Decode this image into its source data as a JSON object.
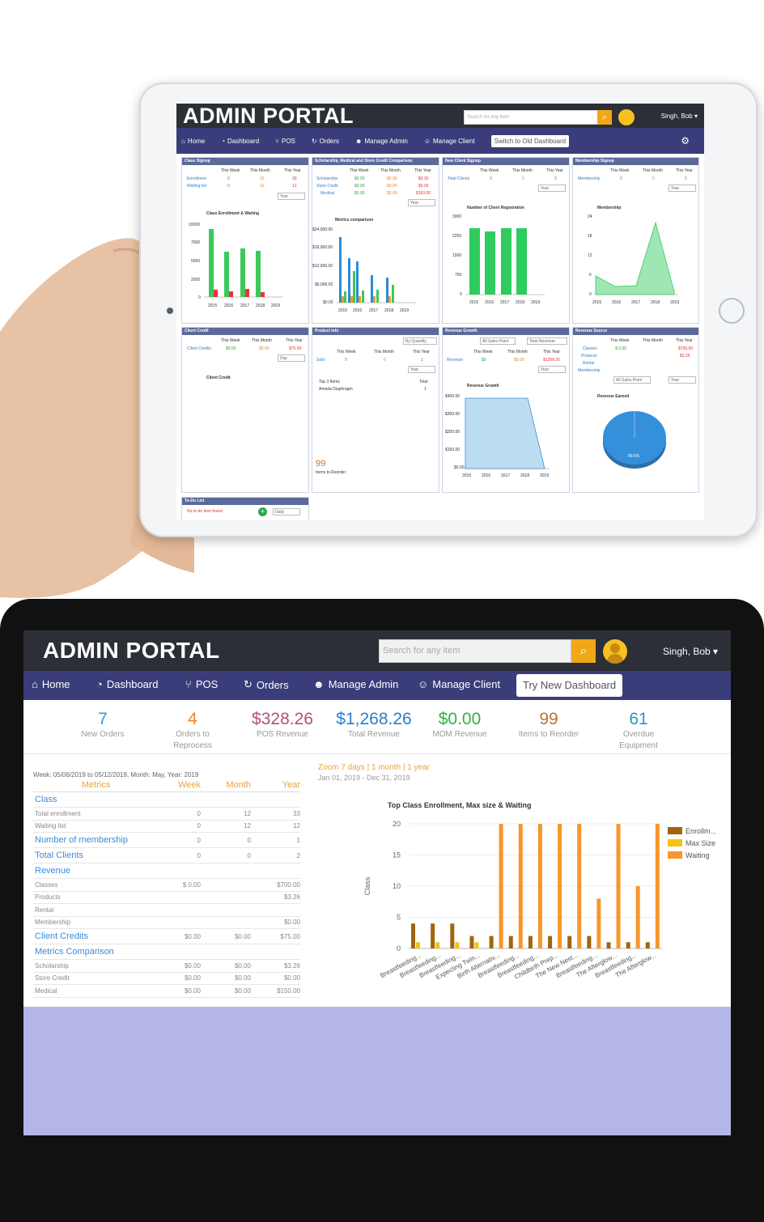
{
  "tablet": {
    "logo": "ADMIN PORTAL",
    "search_placeholder": "Search for any item",
    "user": "Singh, Bob ▾",
    "nav": [
      "Home",
      "Dashboard",
      "POS",
      "Orders",
      "Manage Admin",
      "Manage Client"
    ],
    "switch_label": "Switch to Old Dashboard",
    "panels": {
      "class_signup": {
        "title": "Class Signup",
        "cols": [
          "This Week",
          "This Month",
          "This Year"
        ],
        "rows": [
          [
            "Enrollment",
            "0",
            "12",
            "33"
          ],
          [
            "Waiting list",
            "0",
            "12",
            "12"
          ]
        ],
        "select": "Year",
        "chart_title": "Class Enrollment & Waiting",
        "yticks": [
          "10000",
          "7500",
          "5000",
          "2500",
          "0"
        ],
        "xticks": [
          "2015",
          "2016",
          "2017",
          "2018",
          "2019"
        ]
      },
      "scholarship": {
        "title": "Scholarship, Medical and Store Credit Comparison",
        "cols": [
          "This Week",
          "This Month",
          "This Year"
        ],
        "rows": [
          [
            "Scholarship",
            "$0.00",
            "$0.00",
            "$3.26"
          ],
          [
            "Store Credit",
            "$0.00",
            "$0.00",
            "$0.00"
          ],
          [
            "Medical",
            "$0.00",
            "$0.00",
            "$150.00"
          ]
        ],
        "select": "Year",
        "chart_title": "Metrics comparison",
        "yticks": [
          "$24,000.00",
          "$18,000.00",
          "$12,000.00",
          "$6,000.00",
          "$0.00"
        ],
        "xticks": [
          "2015",
          "2016",
          "2017",
          "2018",
          "2019"
        ]
      },
      "new_client": {
        "title": "New Client Signup",
        "cols": [
          "This Week",
          "This Month",
          "This Year"
        ],
        "rows": [
          [
            "Total Clients",
            "0",
            "0",
            "2"
          ]
        ],
        "select": "Year",
        "chart_title": "Number of Client Registration",
        "yticks": [
          "3000",
          "2250",
          "1500",
          "750",
          "0"
        ],
        "xticks": [
          "2015",
          "2016",
          "2017",
          "2018",
          "2019"
        ]
      },
      "membership": {
        "title": "Membership Signup",
        "cols": [
          "This Week",
          "This Month",
          "This Year"
        ],
        "rows": [
          [
            "Membership",
            "0",
            "0",
            "1"
          ]
        ],
        "select": "Year",
        "chart_title": "Membership",
        "yticks": [
          "24",
          "18",
          "12",
          "6",
          "0"
        ],
        "xticks": [
          "2015",
          "2016",
          "2017",
          "2018",
          "2019"
        ]
      },
      "client_credit": {
        "title": "Client Credit",
        "cols": [
          "This Week",
          "This Month",
          "This Year"
        ],
        "rows": [
          [
            "Client Credits",
            "$0.00",
            "$0.00",
            "$75.00"
          ]
        ],
        "select": "Day",
        "chart_title": "Client Credit"
      },
      "product_info": {
        "title": "Product Info",
        "select": "By Quantity",
        "select2": "Year",
        "cols": [
          "This Week",
          "This Month",
          "This Year"
        ],
        "rows": [
          [
            "Sold",
            "0",
            "0",
            "1"
          ]
        ],
        "top_label": "Top 3 Items",
        "total_label": "Total",
        "item": "Ameda Diaphragm",
        "item_total": "1",
        "reorder_value": "99",
        "reorder_label": "Items to Reorder"
      },
      "revenue_growth": {
        "title": "Revenue Growth",
        "select1": "All Sales Point",
        "select2": "Total Revenue",
        "select3": "Year",
        "cols": [
          "This Week",
          "This Month",
          "This Year"
        ],
        "rows": [
          [
            "Revenue",
            "$0",
            "$0.00",
            "$1268.26"
          ]
        ],
        "chart_title": "Revenue Growth",
        "yticks": [
          "$400.00",
          "$300.00",
          "$200.00",
          "$100.00",
          "$0.00"
        ],
        "xticks": [
          "2015",
          "2016",
          "2017",
          "2018",
          "2019"
        ]
      },
      "revenue_source": {
        "title": "Revenue Source",
        "cols": [
          "This Week",
          "This Month",
          "This Year"
        ],
        "rows": [
          [
            "Classes",
            "$ 0.00",
            "",
            "$700.00"
          ],
          [
            "Products",
            "",
            "",
            "$3.26"
          ],
          [
            "Rental",
            "",
            "",
            ""
          ],
          [
            "Membership",
            "",
            "",
            ""
          ]
        ],
        "select1": "All Sales Point",
        "select2": "Year",
        "chart_title": "Revenue Earned",
        "pie_label": "99.5%"
      },
      "todo": {
        "title": "To-Do List",
        "empty": "No to-do item found",
        "select": "Daily"
      }
    }
  },
  "laptop": {
    "logo": "ADMIN PORTAL",
    "search_placeholder": "Search for any item",
    "user": "Singh, Bob ▾",
    "nav": [
      "Home",
      "Dashboard",
      "POS",
      "Orders",
      "Manage Admin",
      "Manage Client"
    ],
    "try_label": "Try New Dashboard",
    "kpis": [
      {
        "value": "7",
        "label": "New Orders",
        "color": "#29a3d6"
      },
      {
        "value": "4",
        "label": "Orders to Reprocess",
        "color": "#e8862a"
      },
      {
        "value": "$328.26",
        "label": "POS Revenue",
        "color": "#b0507e"
      },
      {
        "value": "$1,268.26",
        "label": "Total Revenue",
        "color": "#2a7fc9"
      },
      {
        "value": "$0.00",
        "label": "MOM Revenue",
        "color": "#33b33a"
      },
      {
        "value": "99",
        "label": "Items to Reorder",
        "color": "#b8732e"
      },
      {
        "value": "61",
        "label": "Overdue Equipment",
        "color": "#2a98b8"
      }
    ],
    "metrics": {
      "week_text": "Week: 05/06/2019 to 05/12/2019, Month: May, Year: 2019",
      "headers": [
        "Metrics",
        "Week",
        "Month",
        "Year"
      ],
      "rows": [
        {
          "label": "Class",
          "section": true,
          "w": "",
          "m": "",
          "y": ""
        },
        {
          "label": "Total enrollment",
          "section": false,
          "w": "0",
          "m": "12",
          "y": "33"
        },
        {
          "label": "Waiting list",
          "section": false,
          "w": "0",
          "m": "12",
          "y": "12"
        },
        {
          "label": "Number of membership",
          "section": true,
          "w": "0",
          "m": "0",
          "y": "1"
        },
        {
          "label": "Total Clients",
          "section": true,
          "w": "0",
          "m": "0",
          "y": "2"
        },
        {
          "label": "Revenue",
          "section": true,
          "w": "",
          "m": "",
          "y": ""
        },
        {
          "label": "Classes",
          "section": false,
          "w": "$ 0.00",
          "m": "",
          "y": "$700.00"
        },
        {
          "label": "Products",
          "section": false,
          "w": "",
          "m": "",
          "y": "$3.26"
        },
        {
          "label": "Rental",
          "section": false,
          "w": "",
          "m": "",
          "y": ""
        },
        {
          "label": "Membership",
          "section": false,
          "w": "",
          "m": "",
          "y": "$0.00"
        },
        {
          "label": "Client Credits",
          "section": true,
          "w": "$0.00",
          "m": "$0.00",
          "y": "$75.00"
        },
        {
          "label": "Metrics Comparison",
          "section": true,
          "w": "",
          "m": "",
          "y": ""
        },
        {
          "label": "Scholarship",
          "section": false,
          "w": "$0.00",
          "m": "$0.00",
          "y": "$3.26"
        },
        {
          "label": "Store Credit",
          "section": false,
          "w": "$0.00",
          "m": "$0.00",
          "y": "$0.00"
        },
        {
          "label": "Medical",
          "section": false,
          "w": "$0.00",
          "m": "$0.00",
          "y": "$150.00"
        }
      ]
    },
    "zoom": {
      "label": "Zoom",
      "opts": [
        "7 days",
        "1 month",
        "1 year"
      ],
      "range": "Jan 01, 2019 - Dec 31, 2019"
    }
  },
  "chart_data": {
    "type": "bar",
    "title": "Top Class Enrollment, Max size & Waiting",
    "ylabel": "Class",
    "ylim": [
      0,
      20
    ],
    "yticks": [
      0,
      5,
      10,
      15,
      20
    ],
    "categories": [
      "Breastfeeding...",
      "Breastfeeding...",
      "Breastfeeding...",
      "Expecting Twin...",
      "Birth Alternativ...",
      "Breastfeeding...",
      "Breastfeeding...",
      "Childbirth Prep...",
      "The New Nest...",
      "Breastfeeding...",
      "The Afterglow...",
      "Breastfeeding...",
      "The Afterglow..."
    ],
    "series": [
      {
        "name": "Enrollm...",
        "color": "#a0660e",
        "values": [
          4,
          4,
          4,
          2,
          2,
          2,
          2,
          2,
          2,
          2,
          1,
          1,
          1
        ]
      },
      {
        "name": "Max Size",
        "color": "#f2c413",
        "values": [
          1,
          1,
          1,
          1,
          0,
          0,
          0,
          0,
          0,
          0,
          0,
          0,
          0
        ]
      },
      {
        "name": "Waiting",
        "color": "#f8962b",
        "values": [
          0,
          0,
          0,
          0,
          20,
          20,
          20,
          20,
          20,
          8,
          20,
          10,
          20
        ]
      }
    ],
    "legend": "right"
  }
}
